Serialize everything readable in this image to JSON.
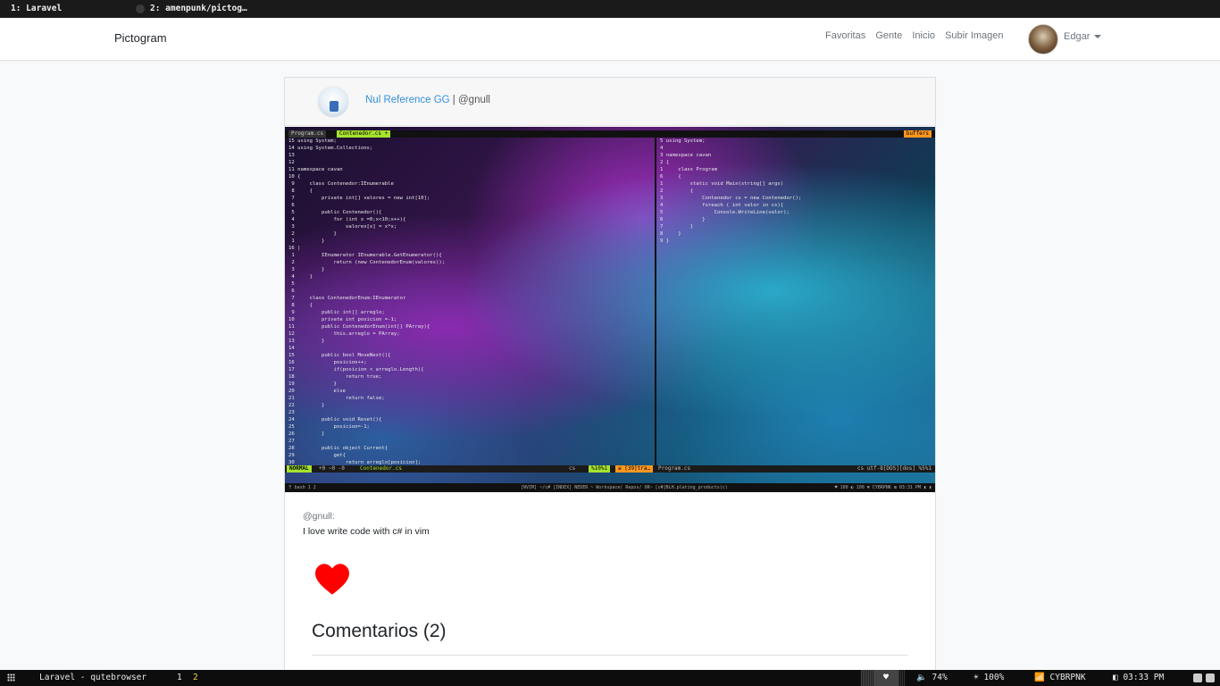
{
  "browser_tabs": [
    {
      "label": "1: Laravel"
    },
    {
      "label": "2: amenpunk/pictog…"
    }
  ],
  "navbar": {
    "brand": "Pictogram",
    "links": [
      "Favoritas",
      "Gente",
      "Inicio",
      "Subir Imagen"
    ],
    "user_name": "Edgar"
  },
  "post": {
    "author_name": "Nul Reference GG",
    "author_sep": " | ",
    "author_handle": "@gnull",
    "caption_handle": "@gnull:",
    "description": "I love write code with c# in vim",
    "comments_title": "Comentarios (2)",
    "screenshot": {
      "tab_left": "Program.cs",
      "tab_right": "Contenedor.cs +",
      "buffers_label": "buffers",
      "left_code": [
        "15 using System;",
        "14 using System.Collections;",
        "13",
        "12",
        "11 namespace cavan",
        "10 {",
        " 9     class Contenedor:IEnumerable",
        " 8     {",
        " 7         private int[] valores = new int[10];",
        " 6",
        " 5         public Contenedor(){",
        " 4             for (int x =0;x<10;x++){",
        " 3                 valores[x] = x*x;",
        " 2             }",
        " 1         }",
        "16 |",
        " 1         IEnumerator IEnumerable.GetEnumerator(){",
        " 2             return (new ContenedorEnum(valores));",
        " 3         }",
        " 4     }",
        " 5",
        " 6",
        " 7     class ContenedorEnum:IEnumerator",
        " 8     {",
        " 9         public int[] arreglo;",
        "10         private int posicion =-1;",
        "11         public ContenedorEnum(int[] PArray){",
        "12             this.arreglo = PArray;",
        "13         }",
        "14",
        "15         public bool MoveNext(){",
        "16             posicion++;",
        "17             if(posicion < arreglo.Length){",
        "18                 return true;",
        "19             }",
        "20             else",
        "21                 return false;",
        "22         }",
        "23",
        "24         public void Reset(){",
        "25             posicion=-1;",
        "26         }",
        "27",
        "28         public object Current{",
        "29             get{",
        "30                 return arreglo[posicion];"
      ],
      "right_code": [
        "5 using System;",
        "4",
        "3 namespace cavan",
        "2 {",
        "1     class Program",
        "6     {",
        "1         static void Main(string[] args)",
        "2         {",
        "3             Contenedor cs = new Contenedor();",
        "4             foreach ( int valor in cs){",
        "5                 Console.WriteLine(valor);",
        "6             }",
        "7         }",
        "8     }",
        "9 }"
      ],
      "status_mode": "NORMAL",
      "status_git": "+0 ~0 -0",
      "status_file": "Contenedor.cs",
      "status_lang": "cs",
      "status_pos": "%10%1",
      "status_err": "≡ [39]tra…",
      "status_right_file": "Program.cs",
      "status_right_info": "cs   utf-8[DOS][dos]   %5%1",
      "bottom_left": "⠿  bash   1  2",
      "bottom_mid": "[NVIM] ~/c# [INDEX] NEDER ~ Workspace( Repos/ OR~ [c#]BLH.plating_products(c)",
      "bottom_right": "♥   100   ◐ 100   ▼ CYBRPNK   ⊞ 03:31 PM  ▮ ▮"
    }
  },
  "statusbar": {
    "window_title": "Laravel - qutebrowser",
    "workspaces": [
      "1",
      "2"
    ],
    "volume": "🔈 74%",
    "brightness": "☀ 100%",
    "wifi": "📶 CYBRPNK",
    "clock": "◧ 03:33 PM",
    "accent": "#f4d03f"
  }
}
